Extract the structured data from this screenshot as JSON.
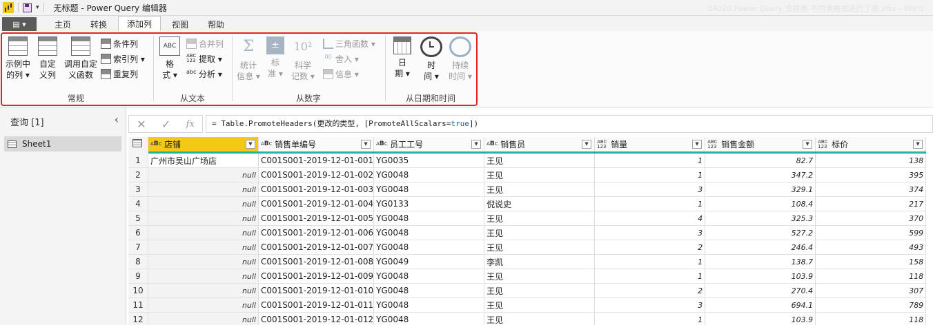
{
  "titlebar": {
    "title": "无标题 - Power Query 编辑器",
    "faint_text": "04020 Power Query 合并表-不同表格式进行了表.xlsx - Word"
  },
  "tabs": {
    "file": "▤ ▾",
    "items": [
      "主页",
      "转换",
      "添加列",
      "视图",
      "帮助"
    ],
    "active": "添加列"
  },
  "ribbon": {
    "general": {
      "label": "常规",
      "example_col": "示例中\n的列 ▾",
      "custom_col": "自定\n义列",
      "invoke_func": "调用自定\n义函数",
      "conditional": "条件列",
      "index": "索引列 ▾",
      "duplicate": "重复列"
    },
    "text": {
      "label": "从文本",
      "format": "格\n式 ▾",
      "merge": "合并列",
      "extract": "提取 ▾",
      "parse": "分析 ▾"
    },
    "number": {
      "label": "从数字",
      "stats": "统计\n信息 ▾",
      "standard": "标\n准 ▾",
      "scientific": "科学\n记数 ▾",
      "trig": "三角函数 ▾",
      "rounding": "舍入 ▾",
      "info": "信息 ▾"
    },
    "datetime": {
      "label": "从日期和时间",
      "date": "日\n期 ▾",
      "time": "时\n间 ▾",
      "duration": "持续\n时间 ▾"
    }
  },
  "querypane": {
    "header": "查询 [1]",
    "items": [
      "Sheet1"
    ]
  },
  "formula": {
    "prefix": "= Table.PromoteHeaders(更改的类型, [PromoteAllScalars=",
    "keyword": "true",
    "suffix": "])"
  },
  "table": {
    "columns": [
      {
        "name": "店铺",
        "type": "ABC"
      },
      {
        "name": "销售单编号",
        "type": "ABC"
      },
      {
        "name": "员工工号",
        "type": "ABC"
      },
      {
        "name": "销售员",
        "type": "ABC"
      },
      {
        "name": "销量",
        "type": "ABC123"
      },
      {
        "name": "销售金额",
        "type": "ABC123"
      },
      {
        "name": "标价",
        "type": "ABC123"
      }
    ],
    "rows": [
      [
        "1",
        "广州市吴山广场店",
        "C001S001-2019-12-01-001",
        "YG0035",
        "王见",
        "1",
        "82.7",
        "138"
      ],
      [
        "2",
        "null",
        "C001S001-2019-12-01-002",
        "YG0048",
        "王见",
        "1",
        "347.2",
        "395"
      ],
      [
        "3",
        "null",
        "C001S001-2019-12-01-003",
        "YG0048",
        "王见",
        "3",
        "329.1",
        "374"
      ],
      [
        "4",
        "null",
        "C001S001-2019-12-01-004",
        "YG0133",
        "倪说史",
        "1",
        "108.4",
        "217"
      ],
      [
        "5",
        "null",
        "C001S001-2019-12-01-005",
        "YG0048",
        "王见",
        "4",
        "325.3",
        "370"
      ],
      [
        "6",
        "null",
        "C001S001-2019-12-01-006",
        "YG0048",
        "王见",
        "3",
        "527.2",
        "599"
      ],
      [
        "7",
        "null",
        "C001S001-2019-12-01-007",
        "YG0048",
        "王见",
        "2",
        "246.4",
        "493"
      ],
      [
        "8",
        "null",
        "C001S001-2019-12-01-008",
        "YG0049",
        "李凯",
        "1",
        "138.7",
        "158"
      ],
      [
        "9",
        "null",
        "C001S001-2019-12-01-009",
        "YG0048",
        "王见",
        "1",
        "103.9",
        "118"
      ],
      [
        "10",
        "null",
        "C001S001-2019-12-01-010",
        "YG0048",
        "王见",
        "2",
        "270.4",
        "307"
      ],
      [
        "11",
        "null",
        "C001S001-2019-12-01-011",
        "YG0048",
        "王见",
        "3",
        "694.1",
        "789"
      ],
      [
        "12",
        "null",
        "C001S001-2019-12-01-012",
        "YG0048",
        "王见",
        "1",
        "103.9",
        "118"
      ]
    ]
  }
}
